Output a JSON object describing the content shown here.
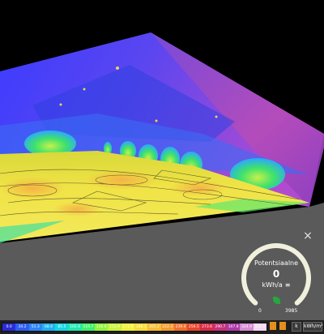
{
  "viewer": {
    "close_label": "×"
  },
  "gauge": {
    "title": "Potentsiaalne",
    "value": "0",
    "unit": "kWh/a",
    "menu_icon": "menu-icon",
    "min_label": "0",
    "max_label": "3985",
    "level": 0,
    "arc_color": "#f1f0dc",
    "leaf_color": "#27a73d"
  },
  "legend": {
    "unit_button": "kWh/m²",
    "toggle_label": "k",
    "classes": [
      {
        "label": "0.0",
        "color": "#2b2bd8"
      },
      {
        "label": "34.2",
        "color": "#2f5ef2"
      },
      {
        "label": "51.3",
        "color": "#2f86f6"
      },
      {
        "label": "68.4",
        "color": "#1fb1f2"
      },
      {
        "label": "85.5",
        "color": "#14d7e3"
      },
      {
        "label": "102.6",
        "color": "#1fe7b0"
      },
      {
        "label": "119.7",
        "color": "#3ff06a"
      },
      {
        "label": "136.8",
        "color": "#8ff53a"
      },
      {
        "label": "153.9",
        "color": "#c9f53a"
      },
      {
        "label": "171.0",
        "color": "#f2f23a"
      },
      {
        "label": "188.1",
        "color": "#f7dc37"
      },
      {
        "label": "205.2",
        "color": "#f7bd33"
      },
      {
        "label": "222.3",
        "color": "#f59a2f"
      },
      {
        "label": "239.4",
        "color": "#f0702b"
      },
      {
        "label": "256.5",
        "color": "#e8462a"
      },
      {
        "label": "273.6",
        "color": "#d92b4a"
      },
      {
        "label": "290.7",
        "color": "#c7307a"
      },
      {
        "label": "307.8",
        "color": "#ad3aa8"
      },
      {
        "label": "324.9",
        "color": "#d68bd6"
      },
      {
        "label": "342.0",
        "color": "#f2d7f2"
      }
    ]
  }
}
